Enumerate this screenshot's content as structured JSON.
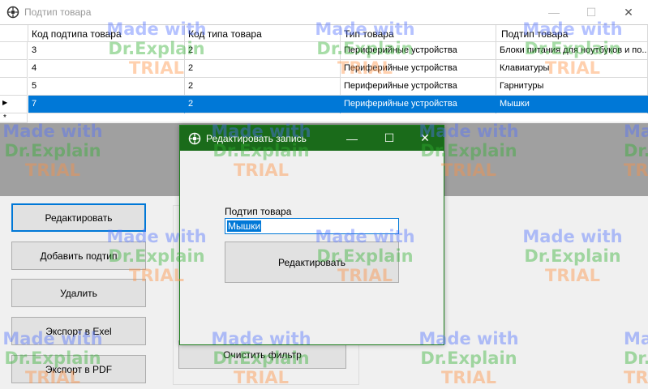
{
  "window": {
    "title": "Подтип товара",
    "minimize": "—",
    "maximize": "☐",
    "close": "✕"
  },
  "grid": {
    "columns": [
      "Код подтипа товара",
      "Код типа товара",
      "Тип товара",
      "Подтип товара"
    ],
    "rows": [
      [
        "3",
        "2",
        "Периферийные устройства",
        "Блоки питания для ноутбуков и по..."
      ],
      [
        "4",
        "2",
        "Периферийные устройства",
        "Клавиатуры"
      ],
      [
        "5",
        "2",
        "Периферийные устройства",
        "Гарнитуры"
      ],
      [
        "7",
        "2",
        "Периферийные устройства",
        "Мышки"
      ]
    ],
    "selected_row": 3,
    "current_row_marker": "▶",
    "new_row_marker": "*"
  },
  "buttons": {
    "edit": "Редактировать",
    "add": "Добавить подтип",
    "delete": "Удалить",
    "export_excel": "Экспорт в Exel",
    "export_pdf": "Экспорт в PDF",
    "clear_filter": "Очистить фильтр"
  },
  "dialog": {
    "title": "Редактировать запись",
    "field_label": "Подтип товара",
    "field_value": "Мышки",
    "submit": "Редактировать",
    "minimize": "—",
    "maximize": "☐",
    "close": "✕"
  },
  "watermark": {
    "line1": "Made with",
    "line2": "Dr.Explain",
    "line3": "TRIAL"
  },
  "colors": {
    "selection": "#0078d7",
    "dialog_titlebar": "#1a6b1a"
  }
}
